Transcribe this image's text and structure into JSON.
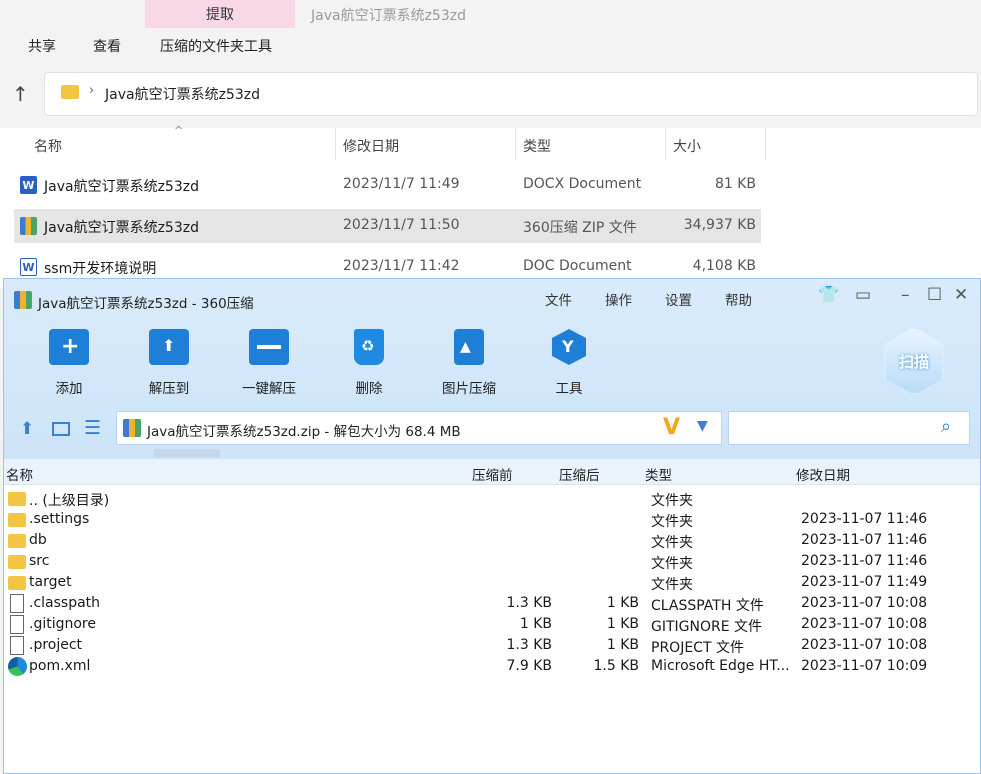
{
  "explorer": {
    "active_tab": "提取",
    "window_title": "Java航空订票系统z53zd",
    "ribbon": [
      "共享",
      "查看",
      "压缩的文件夹工具"
    ],
    "address": "Java航空订票系统z53zd",
    "columns": [
      "名称",
      "修改日期",
      "类型",
      "大小"
    ],
    "files": [
      {
        "icon": "docx-icon",
        "name": "Java航空订票系统z53zd",
        "date": "2023/11/7 11:49",
        "type": "DOCX Document",
        "size": "81 KB"
      },
      {
        "icon": "zip-icon",
        "name": "Java航空订票系统z53zd",
        "date": "2023/11/7 11:50",
        "type": "360压缩 ZIP 文件",
        "size": "34,937 KB"
      },
      {
        "icon": "doc-icon",
        "name": "ssm开发环境说明",
        "date": "2023/11/7 11:42",
        "type": "DOC Document",
        "size": "4,108 KB"
      }
    ]
  },
  "zip360": {
    "title": "Java航空订票系统z53zd - 360压缩",
    "menu": [
      "文件",
      "操作",
      "设置",
      "帮助"
    ],
    "toolbar": [
      {
        "label": "添加",
        "icon": "add-icon"
      },
      {
        "label": "解压到",
        "icon": "extract-to-icon"
      },
      {
        "label": "一键解压",
        "icon": "one-click-extract-icon"
      },
      {
        "label": "删除",
        "icon": "delete-icon"
      },
      {
        "label": "图片压缩",
        "icon": "image-compress-icon"
      },
      {
        "label": "工具",
        "icon": "tools-icon"
      }
    ],
    "scan_label": "扫描",
    "path": "Java航空订票系统z53zd.zip - 解包大小为 68.4 MB",
    "search_placeholder": "",
    "columns": [
      "名称",
      "压缩前",
      "压缩后",
      "类型",
      "修改日期"
    ],
    "rows": [
      {
        "icon": "folder-icon",
        "name": ".. (上级目录)",
        "before": "",
        "after": "",
        "type": "文件夹",
        "date": ""
      },
      {
        "icon": "folder-icon",
        "name": ".settings",
        "before": "",
        "after": "",
        "type": "文件夹",
        "date": "2023-11-07 11:46"
      },
      {
        "icon": "folder-icon",
        "name": "db",
        "before": "",
        "after": "",
        "type": "文件夹",
        "date": "2023-11-07 11:46"
      },
      {
        "icon": "folder-icon",
        "name": "src",
        "before": "",
        "after": "",
        "type": "文件夹",
        "date": "2023-11-07 11:46"
      },
      {
        "icon": "folder-icon",
        "name": "target",
        "before": "",
        "after": "",
        "type": "文件夹",
        "date": "2023-11-07 11:49"
      },
      {
        "icon": "file-icon",
        "name": ".classpath",
        "before": "1.3 KB",
        "after": "1 KB",
        "type": "CLASSPATH 文件",
        "date": "2023-11-07 10:08"
      },
      {
        "icon": "file-icon",
        "name": ".gitignore",
        "before": "1 KB",
        "after": "1 KB",
        "type": "GITIGNORE 文件",
        "date": "2023-11-07 10:08"
      },
      {
        "icon": "file-icon",
        "name": ".project",
        "before": "1.3 KB",
        "after": "1 KB",
        "type": "PROJECT 文件",
        "date": "2023-11-07 10:08"
      },
      {
        "icon": "edge-icon",
        "name": "pom.xml",
        "before": "7.9 KB",
        "after": "1.5 KB",
        "type": "Microsoft Edge HT...",
        "date": "2023-11-07 10:09"
      }
    ]
  },
  "colors": {
    "accent": "#3a7fd0",
    "folder": "#f4c542",
    "tab": "#f8d7e6"
  }
}
